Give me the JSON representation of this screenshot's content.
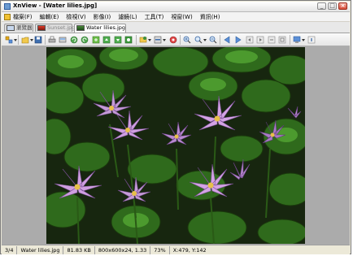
{
  "window": {
    "title": "XnView - [Water lilies.jpg]"
  },
  "menubar": {
    "items": [
      "檔案(F)",
      "編輯(E)",
      "檢視(V)",
      "影像(I)",
      "濾鏡(L)",
      "工具(T)",
      "視窗(W)",
      "資訊(H)"
    ]
  },
  "tabs": [
    {
      "label": "瀏覽器",
      "icon": "browser-icon",
      "active": false
    },
    {
      "label": "Sunset.jpg",
      "icon": "image-icon",
      "active": false
    },
    {
      "label": "Water lilies.jpg",
      "icon": "image-icon",
      "active": true
    }
  ],
  "toolbar": {
    "icons": [
      "browse-icon",
      "open-folder-icon",
      "save-icon",
      "print-icon",
      "scan-icon",
      "rotate-left-icon",
      "rotate-right-icon",
      "convert-icon",
      "refresh-icon",
      "folder-up-icon",
      "resize-icon",
      "effects-icon",
      "zoom-in-icon",
      "zoom-fit-icon",
      "zoom-out-icon",
      "previous-icon",
      "next-icon",
      "first-icon",
      "last-icon",
      "slideshow-icon",
      "fullscreen-icon",
      "settings-icon",
      "info-icon"
    ]
  },
  "image": {
    "subject": "Water lilies"
  },
  "statusbar": {
    "index": "3/4",
    "filename": "Water lilies.jpg",
    "filesize": "81.83 KB",
    "dimensions": "800x600x24, 1.33",
    "zoom": "73%",
    "coords": "X:479, Y:142"
  },
  "colors": {
    "window_bg": "#ece9d8",
    "viewer_bg": "#ababab",
    "close_button": "#d64a35"
  }
}
